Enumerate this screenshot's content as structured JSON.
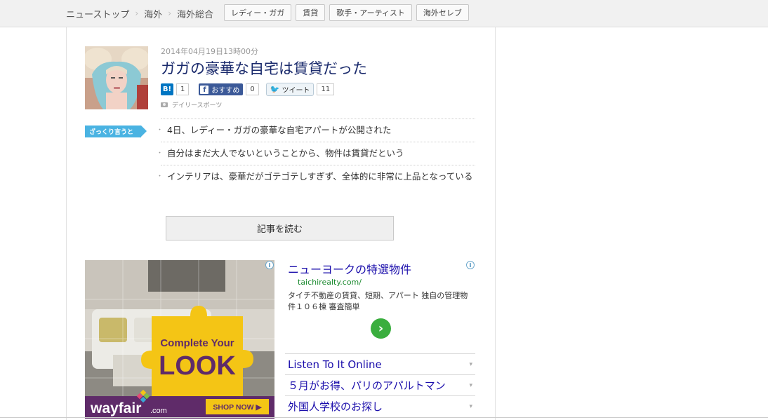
{
  "breadcrumb": [
    "ニューストップ",
    "海外",
    "海外総合"
  ],
  "breadcrumb_sep": "›",
  "tags": [
    "レディー・ガガ",
    "賃貸",
    "歌手・アーティスト",
    "海外セレブ"
  ],
  "article": {
    "date": "2014年04月19日13時00分",
    "title": "ガガの豪華な自宅は賃貸だった",
    "source": "デイリースポーツ"
  },
  "social": {
    "hatena_icon": "B!",
    "hatena_count": "1",
    "facebook_label": "おすすめ",
    "facebook_count": "0",
    "tweet_label": "ツイート",
    "tweet_count": "11"
  },
  "summary": {
    "badge": "ざっくり言うと",
    "points": [
      "4日、レディー・ガガの豪華な自宅アパートが公開された",
      "自分はまだ大人でないということから、物件は賃貸だという",
      "インテリアは、豪華だがゴテゴテしすぎず、全体的に非常に上品となっている"
    ]
  },
  "read_button": "記事を読む",
  "image_ad": {
    "headline_1": "Complete Your",
    "headline_2": "LOOK",
    "brand": "wayfair",
    "brand_suffix": ".com",
    "cta": "SHOP NOW ▶",
    "info": "i"
  },
  "text_ad": {
    "title": "ニューヨークの特選物件",
    "url": "taichirealty.com/",
    "description": "タイチ不動産の賃貸、短期、アパート 独自の管理物件１０６棟 審査簡単",
    "info": "i",
    "go": "›",
    "links": [
      "Listen To It Online",
      "５月がお得、パリのアパルトマン",
      "外国人学校のお探し"
    ],
    "link_chevron": "▾"
  },
  "colors": {
    "title": "#1a2a6c",
    "badge": "#4ab3e2",
    "ad_link": "#1a0dab",
    "ad_url": "#1b8a2f",
    "ad_yellow": "#f4c515",
    "ad_purple": "#5f2b69"
  }
}
